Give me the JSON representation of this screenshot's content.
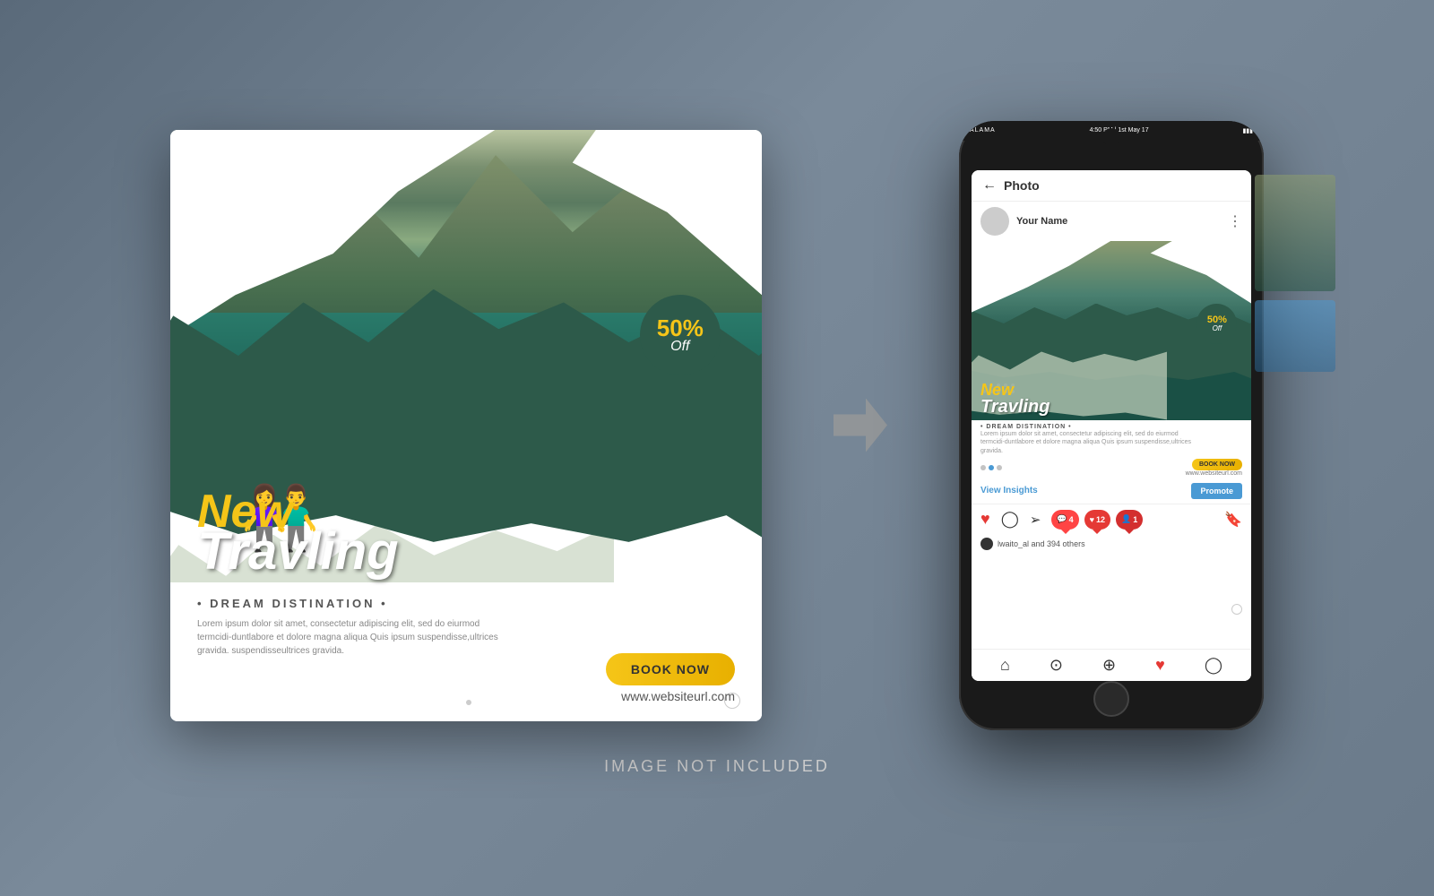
{
  "background": {
    "gradient_start": "#5a6a7a",
    "gradient_end": "#6a7a8a"
  },
  "social_card": {
    "discount": {
      "percent": "50%",
      "off_label": "Off"
    },
    "title_new": "New",
    "title_traveling": "Travling",
    "subtitle": "• DREAM DISTINATION •",
    "body_text": "Lorem ipsum dolor sit amet, consectetur adipiscing elit, sed do eiurmod termcidi-duntlabore et dolore magna aliqua Quis ipsum suspendisse,ultrices gravida. suspendisseultrices gravida.",
    "book_now_label": "BOOK NOW",
    "website_url": "www.websiteurl.com"
  },
  "phone": {
    "status_bar": {
      "carrier": "ALAMA",
      "time": "4:50 PM | 1st May 17"
    },
    "header": {
      "back_label": "←",
      "title": "Photo"
    },
    "post": {
      "username": "Your Name",
      "discount_percent": "50%",
      "discount_off": "Off",
      "title_new": "New",
      "title_traveling": "Travling",
      "subtitle": "• DREAM DISTINATION •",
      "description_short": "Lorem ipsum dolor sit amet, consectetur adipiscing elit, sed do eiurmod termcidi-duntlabore et dolore magna aliqua Quis ipsum suspendisse,ultrices gravida."
    },
    "actions": {
      "view_insights": "View Insights",
      "promote": "Promote"
    },
    "badges": {
      "comment_count": "4",
      "like_count": "12",
      "message_count": "1"
    },
    "likes_text": "lwaito_al  and 394 others",
    "book_now_label": "BOOK NOW",
    "website_url": "www.websiteurl.com"
  },
  "bottom_label": "IMAGE NOT INCLUDED"
}
